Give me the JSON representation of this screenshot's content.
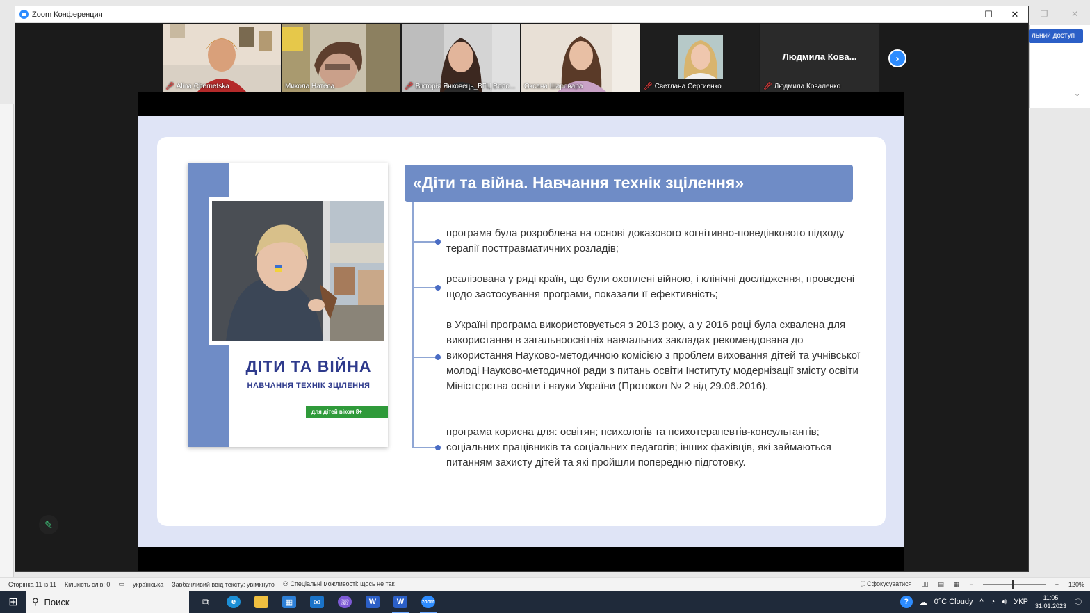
{
  "zoom_window": {
    "title": "Zoom Конференция",
    "controls": {
      "minimize": "—",
      "maximize": "☐",
      "close": "✕"
    }
  },
  "word": {
    "share_button": "льний доступ",
    "status": {
      "page": "Сторінка 11 із 11",
      "words": "Кількість слів: 0",
      "language": "українська",
      "predictive": "Завбачливий ввід тексту: увімкнуто",
      "accessibility": "Спеціальні можливості: щось не так",
      "focus": "Сфокусуватися",
      "zoom": "120%"
    }
  },
  "participants": [
    {
      "name": "Alina Chernetska",
      "muted": true
    },
    {
      "name": "Микола Натеса",
      "muted": false
    },
    {
      "name": "Вікторія Янковець_ВГЦ Воло...",
      "muted": true
    },
    {
      "name": "Оксана Шароварa",
      "muted": false,
      "active": true
    },
    {
      "name": "Светлана Сергиенко",
      "muted": true
    },
    {
      "name": "Людмила Коваленко",
      "muted": true,
      "video_off_label": "Людмила Кова..."
    }
  ],
  "slide": {
    "heading": "«Діти та війна. Навчання технік зцілення»",
    "book": {
      "title": "ДІТИ ТА ВІЙНА",
      "subtitle": "НАВЧАННЯ ТЕХНІК ЗЦІЛЕННЯ",
      "age_badge": "для дітей віком 8+"
    },
    "bullets": [
      "програма була розроблена на основі доказового когнітивно-поведінкового підходу терапії посттравматичних розладів;",
      "реалізована у ряді країн, що були охоплені війною, і клінічні дослідження, проведені щодо застосування програми, показали її ефективність;",
      "в Україні програма використовується з 2013 року, а у 2016 році була схвалена для використання в загальноосвітніх навчальних закладах рекомендована до використання Науково-методичною комісією з проблем виховання дітей та учнівської молоді Науково-методичної ради з питань освіти Інституту модернізації змісту освіти Міністерства освіти і науки України (Протокол № 2 від 29.06.2016).",
      "програма корисна для: освітян; психологів та психотерапевтів-консультантів; соціальних працівників та соціальних педагогів; інших фахівців, які займаються питанням захисту дітей та які пройшли попередню підготовку."
    ]
  },
  "taskbar": {
    "search_placeholder": "Поиск",
    "weather": "0°C  Cloudy",
    "lang": "УКР",
    "time": "11:05",
    "date": "31.01.2023",
    "notifications": "2"
  },
  "colors": {
    "slide_accent": "#6f8cc6",
    "zoom_blue": "#2d8cff",
    "book_green": "#2f9a3a"
  }
}
